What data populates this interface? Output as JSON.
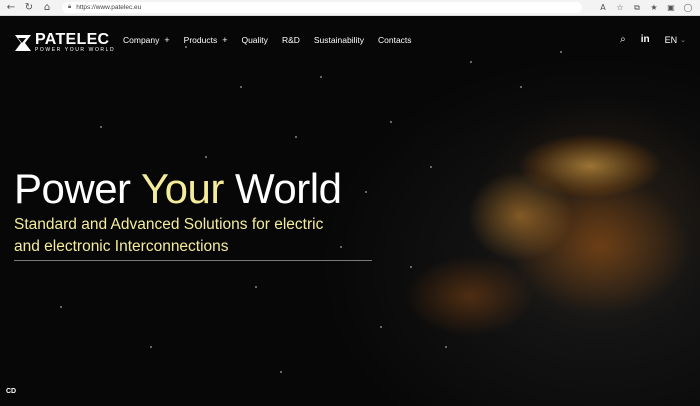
{
  "browser": {
    "url": "https://www.patelec.eu",
    "icons": [
      "back-arrow-icon",
      "refresh-icon",
      "home-icon",
      "lock-icon",
      "read-aloud-icon",
      "favorite-star-icon",
      "extensions-icon",
      "favorites-bar-icon",
      "collections-icon",
      "profile-icon"
    ]
  },
  "header": {
    "logo_name": "PATELEC",
    "logo_tagline": "POWER YOUR WORLD",
    "menu": [
      {
        "label": "Company",
        "plus": "+"
      },
      {
        "label": "Products",
        "plus": "+"
      },
      {
        "label": "Quality"
      },
      {
        "label": "R&D"
      },
      {
        "label": "Sustainability"
      },
      {
        "label": "Contacts"
      }
    ],
    "linkedin": "in",
    "language": "EN"
  },
  "hero": {
    "headline_part1": "Power ",
    "headline_accent": "Your",
    "headline_part2": " World",
    "subtitle": "Standard and Advanced Solutions for electric and electronic Interconnections",
    "corner_label": "CD"
  },
  "colors": {
    "accent": "#f4ec9b",
    "background": "#0b0b0b",
    "text": "#ffffff"
  }
}
